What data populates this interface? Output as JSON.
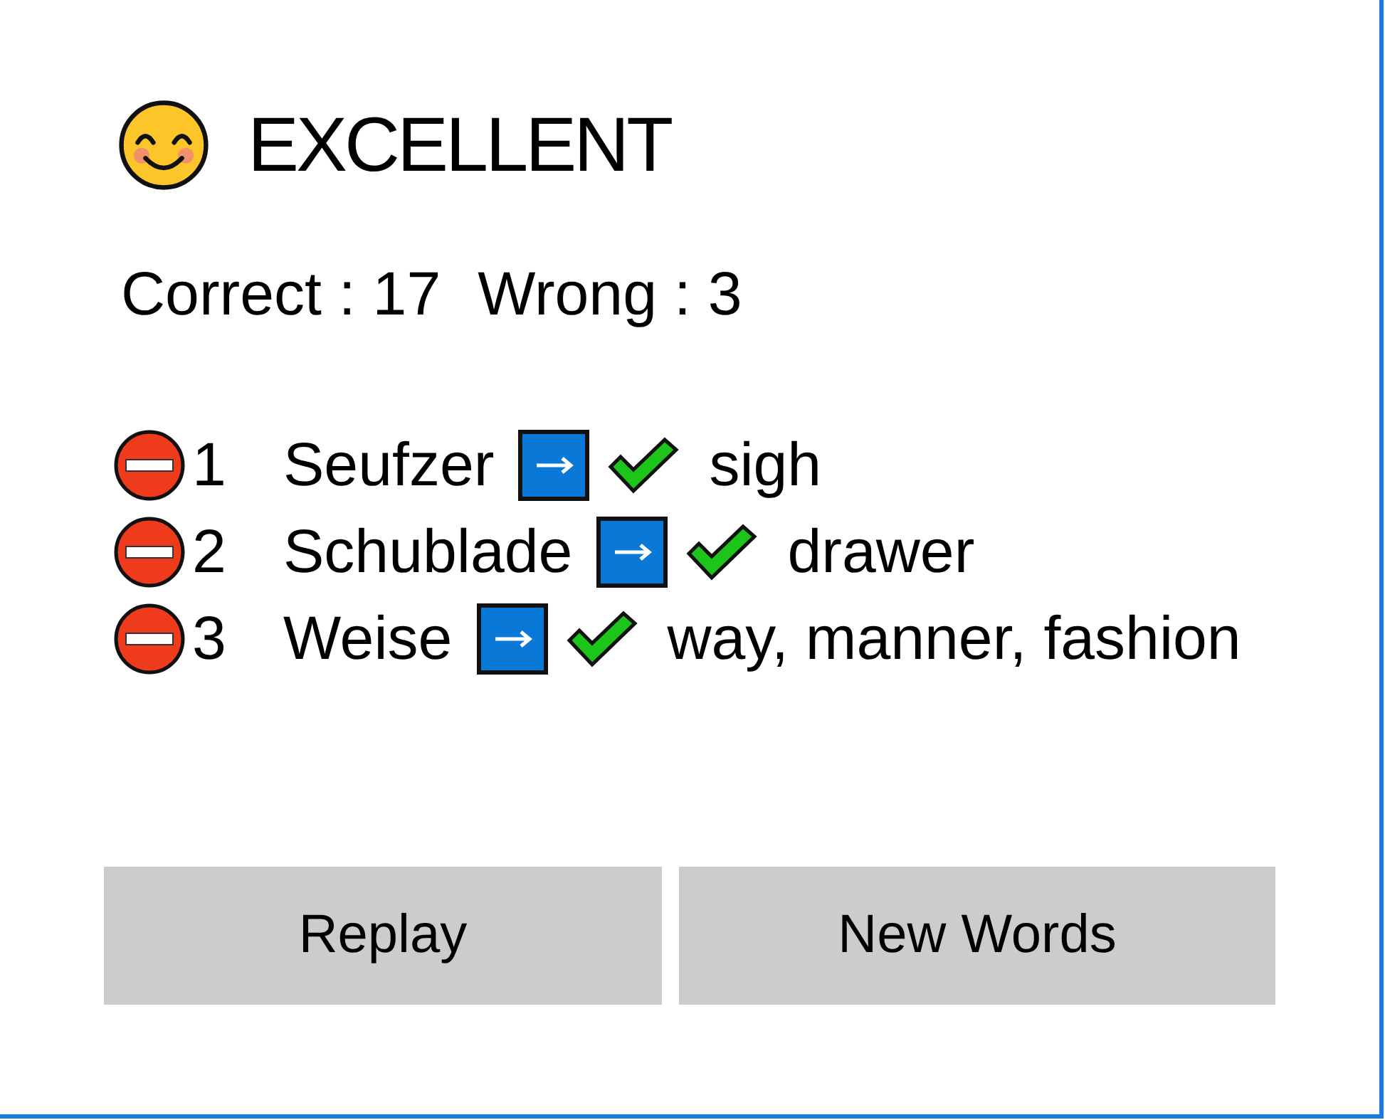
{
  "result": {
    "rating": "EXCELLENT"
  },
  "score": [
    "Correct : 17",
    "Wrong : 3"
  ],
  "mistakes": [
    {
      "number": "1",
      "word": "Seufzer",
      "translation": "sigh"
    },
    {
      "number": "2",
      "word": "Schublade",
      "translation": "drawer"
    },
    {
      "number": "3",
      "word": "Weise",
      "translation": "way, manner, fashion"
    }
  ],
  "buttons": [
    "Replay",
    "New Words"
  ]
}
